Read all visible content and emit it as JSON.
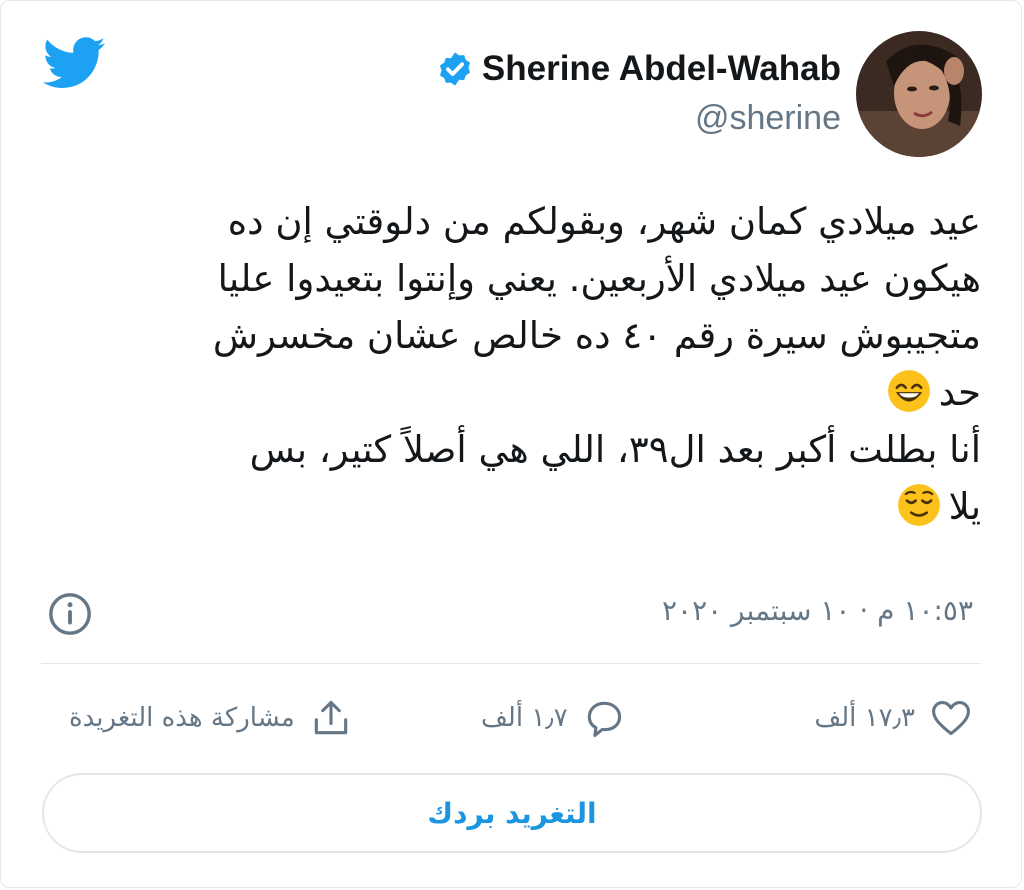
{
  "colors": {
    "brand": "#1da1f2",
    "link": "#1b95e0",
    "text": "#14171a",
    "muted": "#657786",
    "border": "#e1e8ed"
  },
  "header": {
    "name": "Sherine Abdel-Wahab",
    "handle": "@sherine",
    "verified": true,
    "logo_icon": "twitter-bird-icon",
    "verified_icon": "verified-badge-icon"
  },
  "tweet": {
    "lines": [
      "عيد ميلادي كمان شهر، وبقولكم من دلوقتي إن ده",
      "هيكون عيد ميلادي الأربعين. يعني وإنتوا بتعيدوا عليا",
      "متجيبوش سيرة رقم ٤٠ ده خالص عشان مخسرش",
      "حد",
      "أنا بطلت أكبر بعد ال٣٩، اللي هي أصلاً كتير، بس",
      "يلا"
    ],
    "emojis": [
      "grinning-face-icon",
      "relieved-face-icon"
    ]
  },
  "meta": {
    "timestamp": "١٠:٥٣ م · ١٠ سبتمبر ٢٠٢٠",
    "info_icon": "info-icon"
  },
  "actions": {
    "like_count": "١٧٫٣ ألف",
    "reply_count": "١٫٧ ألف",
    "share_label": "مشاركة هذه التغريدة",
    "like_icon": "heart-icon",
    "reply_icon": "speech-bubble-icon",
    "share_icon": "share-upload-icon"
  },
  "reply_button": {
    "label": "التغريد بردك"
  }
}
